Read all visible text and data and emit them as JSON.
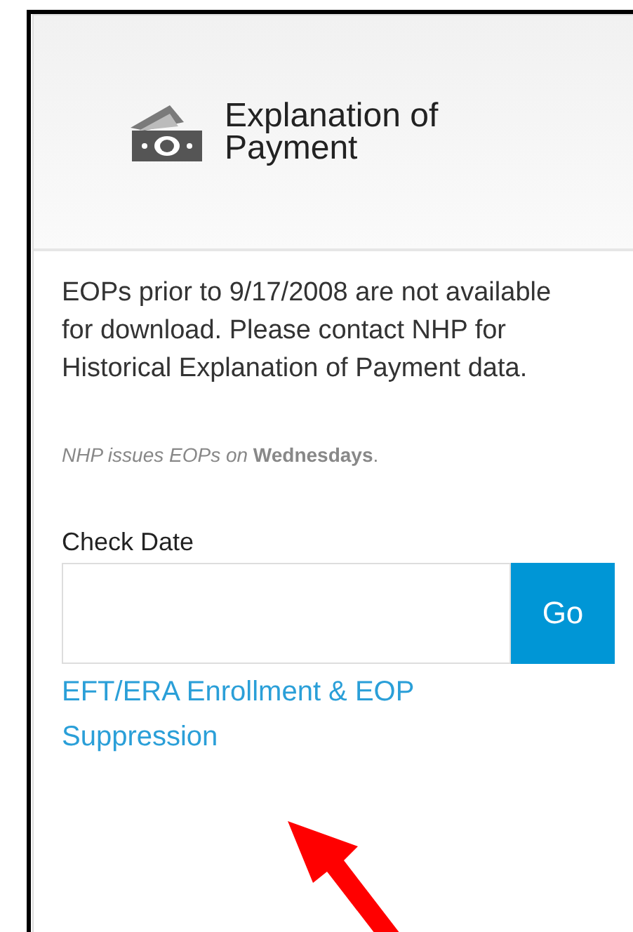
{
  "header": {
    "title": "Explanation of Payment"
  },
  "notice": "EOPs prior to 9/17/2008 are not available for download. Please contact NHP for Historical Explanation of Payment data.",
  "schedule_note": "*NHP issues EOPs on* **Wednesdays**.",
  "check_date": {
    "label": "Check Date",
    "button": "Go"
  },
  "link": "EFT/ERA Enrollment & EOP Suppression"
}
